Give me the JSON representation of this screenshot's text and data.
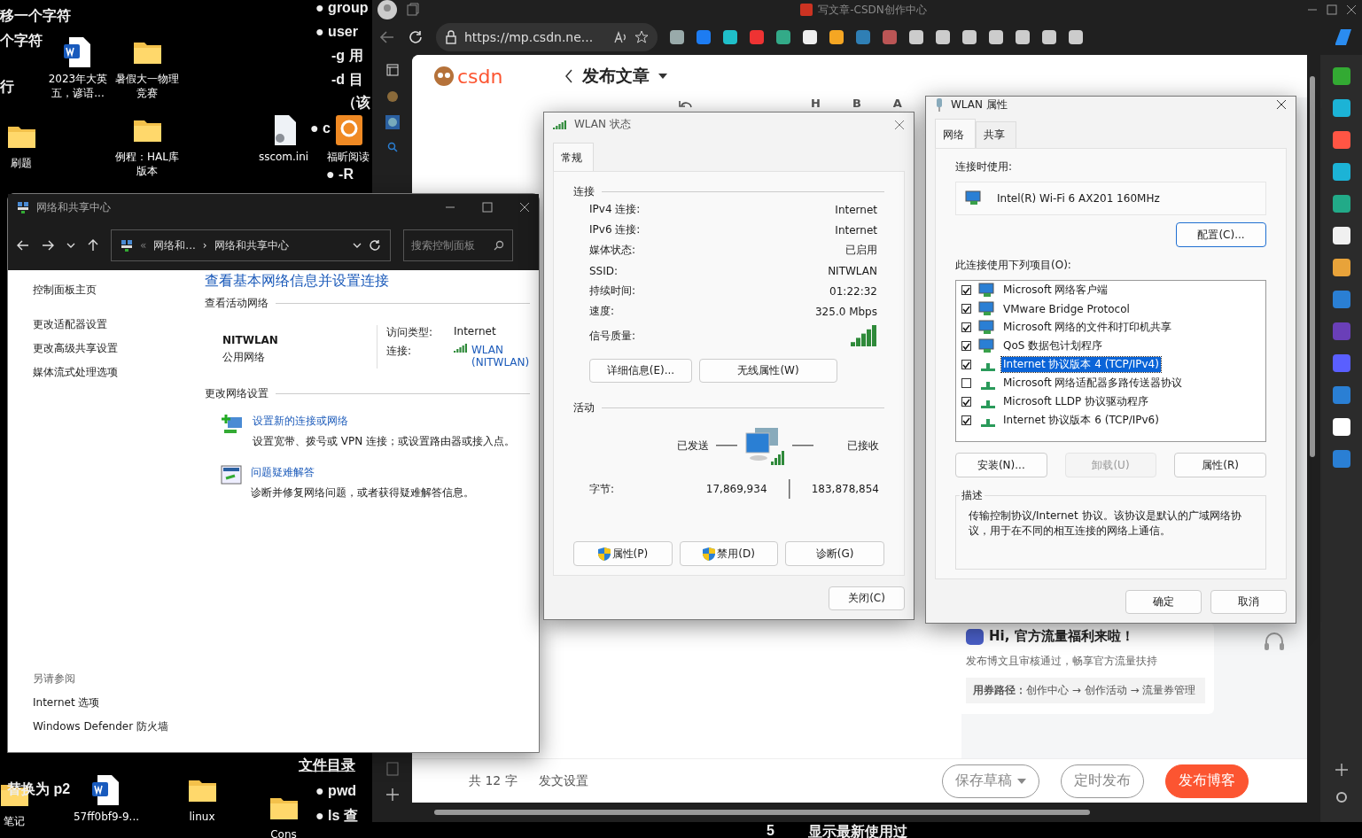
{
  "desktop": {
    "background_text": [
      "移一个字符",
      "个字符",
      "行",
      "● group",
      "● user",
      "-g 用",
      "-d 目",
      "（该",
      "● c",
      "● -R",
      "文件目录",
      "● pwd",
      "● ls 查",
      "替换为 p2",
      "5",
      "显示最新使用过"
    ],
    "icons": [
      {
        "label": "2023年大英五，谚语...",
        "kind": "word"
      },
      {
        "label": "暑假大一物理竞赛",
        "kind": "folder"
      },
      {
        "label": "刷题",
        "kind": "folder"
      },
      {
        "label": "例程：HAL库版本",
        "kind": "folder"
      },
      {
        "label": "sscom.ini",
        "kind": "file"
      },
      {
        "label": "福昕阅读",
        "kind": "pdf"
      },
      {
        "label": "57ff0bf9-9...",
        "kind": "word"
      },
      {
        "label": "linux",
        "kind": "folder"
      },
      {
        "label": "Cons",
        "kind": "folder"
      },
      {
        "label": "笔记",
        "kind": "folder"
      }
    ]
  },
  "browser": {
    "title": "写文章-CSDN创作中心",
    "url": "https://mp.csdn.ne...",
    "page": {
      "logo": "csdn",
      "heading": "发布文章",
      "toolbar_letters": [
        "H",
        "B",
        "A"
      ],
      "promo": {
        "title": "Hi, 官方流量福利来啦！",
        "text": "发布博文且审核通过，畅享官方流量扶持",
        "path": "**用券路径：**创作中心 → 创作活动 → 流量券管理"
      },
      "footer": {
        "word_count": "共 12 字",
        "settings": "发文设置",
        "buttons": [
          {
            "label": "保存草稿",
            "kind": "dropdown"
          },
          {
            "label": "定时发布",
            "kind": "outline"
          },
          {
            "label": "发布博客",
            "kind": "primary"
          }
        ]
      }
    }
  },
  "network_center": {
    "title": "网络和共享中心",
    "breadcrumb": [
      "«",
      "网络和...",
      "›",
      "网络和共享中心"
    ],
    "search": {
      "placeholder": "搜索控制面板"
    },
    "sidebar": {
      "links": [
        "控制面板主页",
        "更改适配器设置",
        "更改高级共享设置",
        "媒体流式处理选项"
      ],
      "see_also": "另请参阅",
      "see_also_links": [
        "Internet 选项",
        "Windows Defender 防火墙"
      ]
    },
    "heading": "查看基本网络信息并设置连接",
    "active_section": "查看活动网络",
    "network": {
      "name": "NITWLAN",
      "type": "公用网络",
      "access_label": "访问类型:",
      "access": "Internet",
      "connection_label": "连接:",
      "connection": "WLAN (NITWLAN)"
    },
    "change_section": "更改网络设置",
    "tasks": [
      {
        "link": "设置新的连接或网络",
        "text": "设置宽带、拨号或 VPN 连接；或设置路由器或接入点。",
        "kind": "setup"
      },
      {
        "link": "问题疑难解答",
        "text": "诊断并修复网络问题，或者获得疑难解答信息。",
        "kind": "troubleshoot"
      }
    ]
  },
  "wlan_status": {
    "title": "WLAN 状态",
    "tabs": [
      {
        "label": "常规",
        "selected": true
      }
    ],
    "connection_section": "连接",
    "rows": [
      {
        "label": "IPv4 连接:",
        "value": "Internet",
        "kind": "text"
      },
      {
        "label": "IPv6 连接:",
        "value": "Internet",
        "kind": "text"
      },
      {
        "label": "媒体状态:",
        "value": "已启用",
        "kind": "text"
      },
      {
        "label": "SSID:",
        "value": "NITWLAN",
        "kind": "text"
      },
      {
        "label": "持续时间:",
        "value": "01:22:32",
        "kind": "text"
      },
      {
        "label": "速度:",
        "value": "325.0 Mbps",
        "kind": "text"
      },
      {
        "label": "信号质量:",
        "kind": "signal"
      }
    ],
    "detail_buttons": [
      "详细信息(E)...",
      "无线属性(W)"
    ],
    "activity_section": "活动",
    "sent_label": "已发送",
    "received_label": "已接收",
    "bytes_label": "字节:",
    "bytes_sent": "17,869,934",
    "bytes_received": "183,878,854",
    "buttons": [
      {
        "label": "属性(P)",
        "shield": true
      },
      {
        "label": "禁用(D)",
        "shield": true
      },
      {
        "label": "诊断(G)",
        "shield": false
      }
    ],
    "close": "关闭(C)"
  },
  "wlan_properties": {
    "title": "WLAN 属性",
    "tabs": [
      {
        "label": "网络",
        "selected": true
      },
      {
        "label": "共享",
        "selected": false
      }
    ],
    "connect_using": "连接时使用:",
    "adapter": "Intel(R) Wi-Fi 6 AX201 160MHz",
    "configure": "配置(C)...",
    "items_label": "此连接使用下列项目(O):",
    "items": [
      {
        "label": "Microsoft 网络客户端",
        "checked": true,
        "selected": false,
        "kind": "service"
      },
      {
        "label": "VMware Bridge Protocol",
        "checked": true,
        "selected": false,
        "kind": "service"
      },
      {
        "label": "Microsoft 网络的文件和打印机共享",
        "checked": true,
        "selected": false,
        "kind": "service"
      },
      {
        "label": "QoS 数据包计划程序",
        "checked": true,
        "selected": false,
        "kind": "service"
      },
      {
        "label": "Internet 协议版本 4 (TCP/IPv4)",
        "checked": true,
        "selected": true,
        "kind": "protocol"
      },
      {
        "label": "Microsoft 网络适配器多路传送器协议",
        "checked": false,
        "selected": false,
        "kind": "protocol"
      },
      {
        "label": "Microsoft LLDP 协议驱动程序",
        "checked": true,
        "selected": false,
        "kind": "protocol"
      },
      {
        "label": "Internet 协议版本 6 (TCP/IPv6)",
        "checked": true,
        "selected": false,
        "kind": "protocol"
      }
    ],
    "buttons": [
      {
        "label": "安装(N)...",
        "disabled": false
      },
      {
        "label": "卸载(U)",
        "disabled": true
      },
      {
        "label": "属性(R)",
        "disabled": false
      }
    ],
    "description_label": "描述",
    "description": "传输控制协议/Internet 协议。该协议是默认的广域网络协议，用于在不同的相互连接的网络上通信。",
    "ok": "确定",
    "cancel": "取消"
  }
}
